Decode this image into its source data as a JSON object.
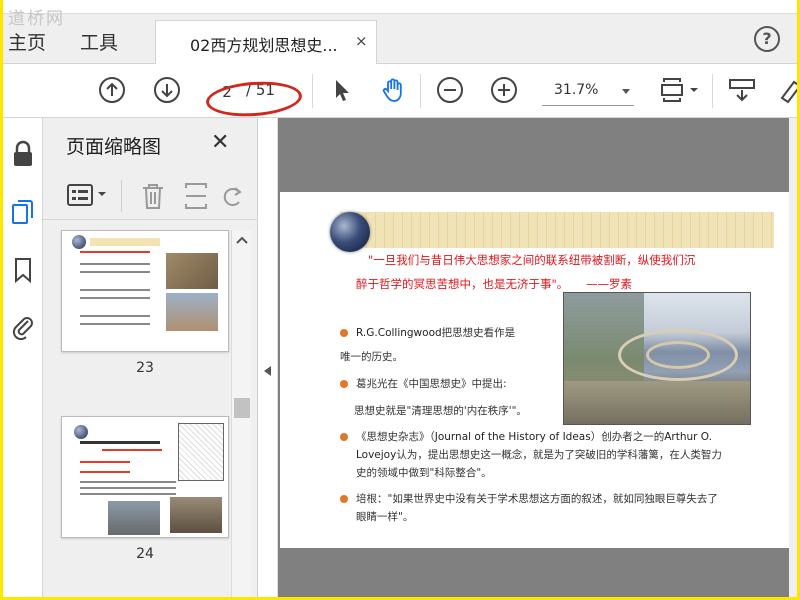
{
  "menu": {
    "home": "主页",
    "tools": "工具"
  },
  "watermark": "道桥网",
  "document_tab": {
    "title": "02西方规划思想史...",
    "close": "×"
  },
  "help": "?",
  "toolbar": {
    "page_current": "2",
    "page_total": "/ 51",
    "zoom": "31.7%"
  },
  "panel": {
    "title": "页面缩略图",
    "close": "✕",
    "thumbnails": [
      {
        "page": "23"
      },
      {
        "page": "24"
      }
    ]
  },
  "page": {
    "quote_line1": "\"一旦我们与昔日伟大思想家之间的联系纽带被割断，纵使我们沉",
    "quote_line2": "醉于哲学的冥思苦想中，也是无济于事\"。",
    "quote_author": "——罗素",
    "b1_en": "R.G.Collingwood",
    "b1_zh": "把思想史看作是",
    "b1_line2": "唯一的历史。",
    "b2_line1": "葛兆光在《中国思想史》中提出:",
    "b2_line2": "思想史就是\"清理思想的'内在秩序'\"。",
    "b3_zh1": "《思想史杂志》（",
    "b3_en": "Journal of the History of Ideas",
    "b3_zh2": "）创办者之一的",
    "b3_en2": "Arthur O.",
    "b3_en3": "Lovejoy",
    "b3_line2": "认为，提出思想史这一概念，就是为了突破旧的学科藩篱，在人类智力",
    "b3_line3": "史的领域中做到\"科际整合\"。",
    "b4_line1": "培根：\"如果世界史中没有关于学术思想这方面的叙述，就如同独眼巨尊失去了",
    "b4_line2": "眼睛一样\"。"
  },
  "colors": {
    "accent_red": "#d0281c",
    "quote_red": "#e4141a",
    "bullet_orange": "#e0782a",
    "hand_tool_blue": "#1473e6",
    "frame_yellow": "#ffe600"
  }
}
